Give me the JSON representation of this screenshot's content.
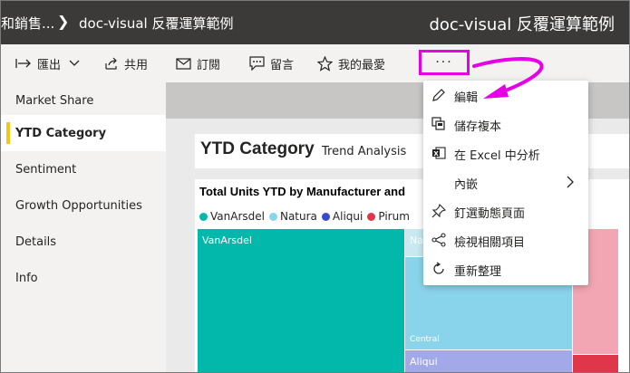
{
  "titlebar": {
    "breadcrumb_1": "和銷售...",
    "breadcrumb_2": "doc-visual 反覆運算範例",
    "report_title": "doc-visual 反覆運算範例"
  },
  "toolbar": {
    "export_label": "匯出",
    "share_label": "共用",
    "subscribe_label": "訂閱",
    "comments_label": "留言",
    "favorite_label": "我的最愛",
    "more_label": "···"
  },
  "nav": {
    "items": [
      {
        "label": "Market Share",
        "active": false
      },
      {
        "label": "YTD Category",
        "active": true
      },
      {
        "label": "Sentiment",
        "active": false
      },
      {
        "label": "Growth Opportunities",
        "active": false
      },
      {
        "label": "Details",
        "active": false
      },
      {
        "label": "Info",
        "active": false
      }
    ]
  },
  "report": {
    "title": "YTD Category",
    "subtitle": "Trend Analysis"
  },
  "visual": {
    "title": "Total Units YTD by Manufacturer and",
    "legend": [
      {
        "label": "VanArsdel",
        "color": "#01b8aa"
      },
      {
        "label": "Natura",
        "color": "#8ad4eb"
      },
      {
        "label": "Aliqui",
        "color": "#3b49c8"
      },
      {
        "label": "Pirum",
        "color": "#e0364a"
      }
    ],
    "tiles": {
      "vanarsdel": "VanArsdel",
      "natura": "Na",
      "central": "Central",
      "aliqui": "Aliqui"
    }
  },
  "menu": {
    "items": [
      {
        "label": "編輯",
        "icon": "pencil-icon"
      },
      {
        "label": "儲存複本",
        "icon": "copy-icon"
      },
      {
        "label": "在 Excel 中分析",
        "icon": "excel-icon"
      },
      {
        "label": "內嵌",
        "icon": "",
        "has_submenu": true
      },
      {
        "label": "釘選動態頁面",
        "icon": "pin-icon"
      },
      {
        "label": "檢視相關項目",
        "icon": "related-icon"
      },
      {
        "label": "重新整理",
        "icon": "refresh-icon"
      }
    ]
  },
  "colors": {
    "titlebar_bg": "#3b3a39",
    "accent_yellow": "#f2c811",
    "highlight_magenta": "#e600e6"
  }
}
